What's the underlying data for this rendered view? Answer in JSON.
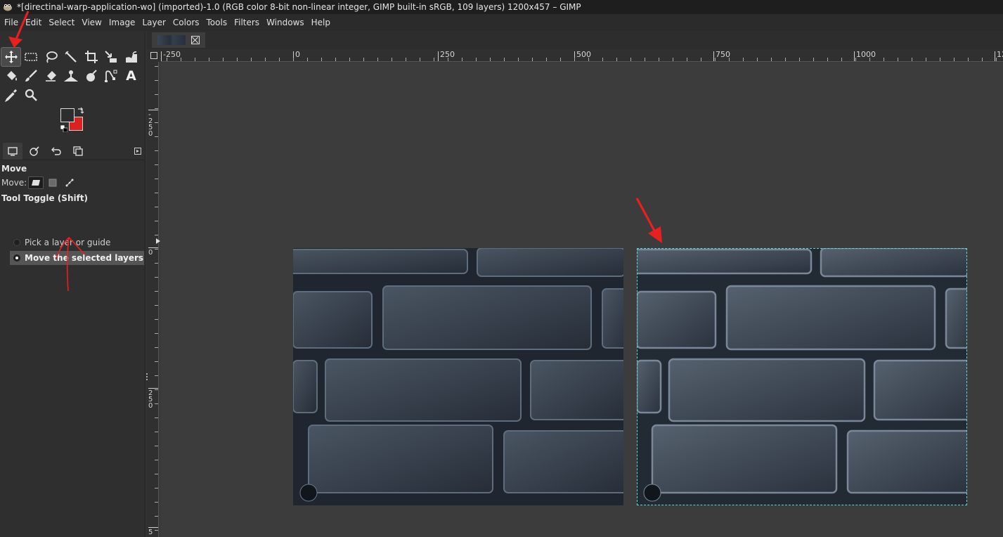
{
  "window": {
    "title": "*[directinal-warp-application-wo] (imported)-1.0 (RGB color 8-bit non-linear integer, GIMP built-in sRGB, 109 layers) 1200x457 – GIMP"
  },
  "menu": [
    "File",
    "Edit",
    "Select",
    "View",
    "Image",
    "Layer",
    "Colors",
    "Tools",
    "Filters",
    "Windows",
    "Help"
  ],
  "toolbox": {
    "tools_row1": [
      "move-tool-icon",
      "rect-select-icon",
      "free-select-icon",
      "fuzzy-select-icon",
      "crop-icon",
      "unified-transform-icon",
      "warp-transform-icon"
    ],
    "tools_row2": [
      "bucket-fill-icon",
      "paintbrush-icon",
      "eraser-icon",
      "clone-icon",
      "smudge-icon",
      "paths-icon",
      "text-tool-icon"
    ],
    "tools_row3": [
      "color-picker-icon",
      "zoom-icon"
    ],
    "active_tool": "move-tool-icon",
    "text_tool_glyph": "A",
    "foreground_color": "#2d2d2d",
    "background_color": "#e02020"
  },
  "tool_options": {
    "title": "Move",
    "move_label": "Move:",
    "toggle_title": "Tool Toggle  (Shift)",
    "options": [
      {
        "label": "Pick a layer or guide",
        "selected": false
      },
      {
        "label": "Move the selected layers",
        "selected": true
      }
    ]
  },
  "rulers": {
    "horizontal_labels": [
      "-250",
      "0",
      "250",
      "500",
      "750",
      "1000",
      "12"
    ],
    "vertical_labels": [
      "-250",
      "0",
      "250",
      "5"
    ]
  },
  "colors": {
    "annotation": "#e8201f",
    "selection_outline": "#5fd7d7",
    "canvas_bg": "#3c3c3c"
  }
}
